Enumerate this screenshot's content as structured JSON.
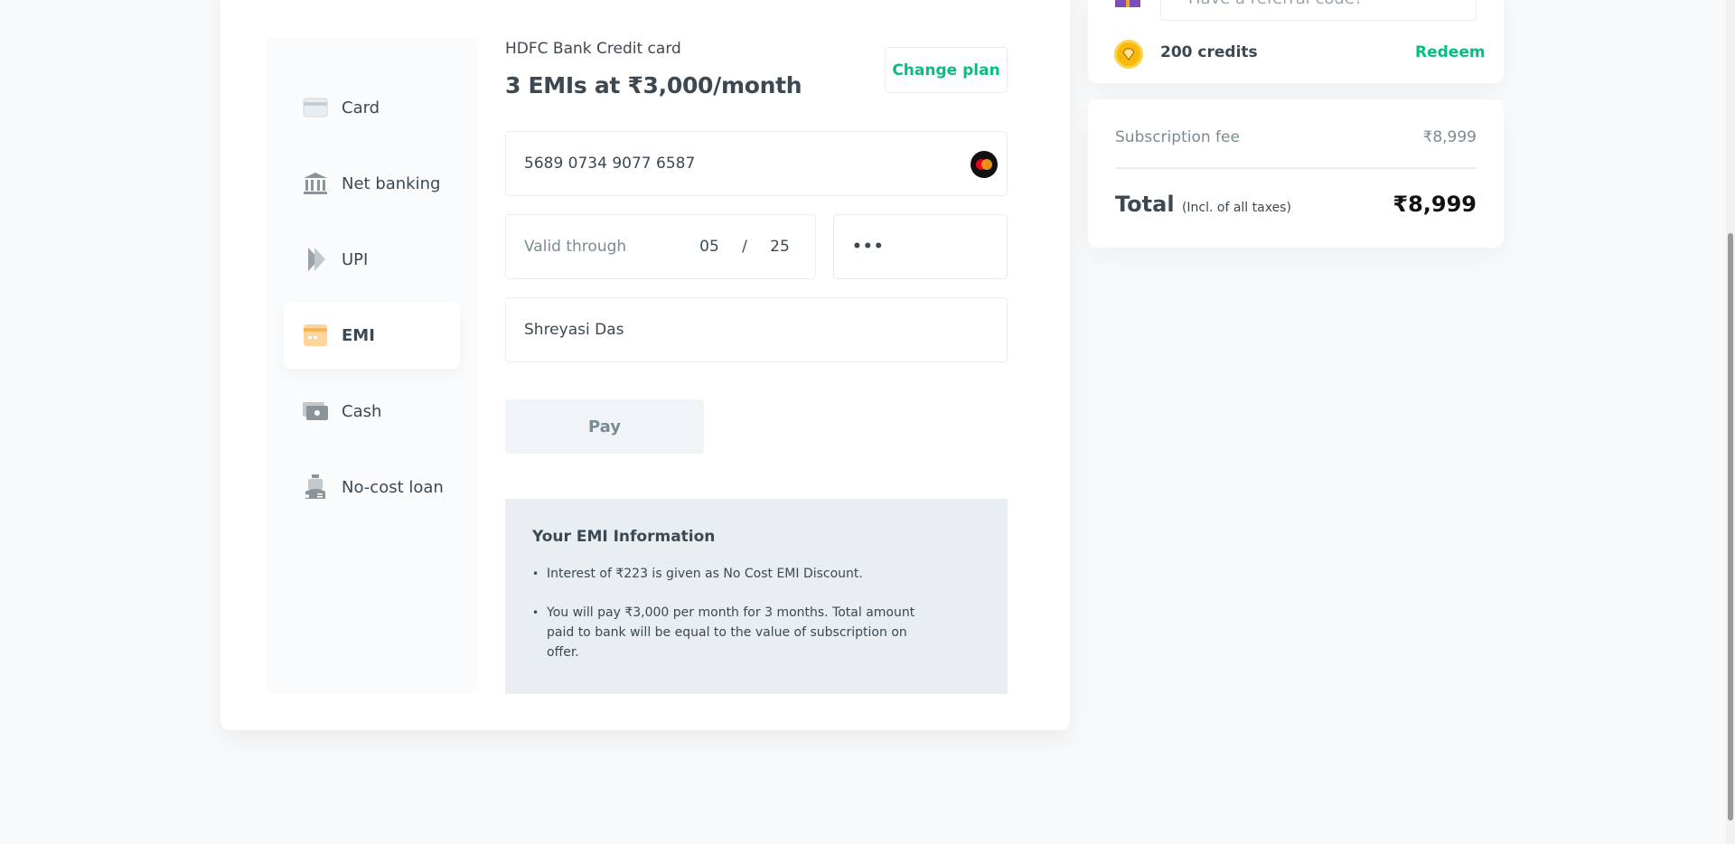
{
  "payment_methods": [
    {
      "label": "Card",
      "icon": "card-icon"
    },
    {
      "label": "Net banking",
      "icon": "bank-icon"
    },
    {
      "label": "UPI",
      "icon": "upi-icon"
    },
    {
      "label": "EMI",
      "icon": "emi-icon",
      "active": true
    },
    {
      "label": "Cash",
      "icon": "cash-icon"
    },
    {
      "label": "No-cost loan",
      "icon": "loan-icon"
    }
  ],
  "emi": {
    "bank_name": "HDFC Bank Credit card",
    "plan": "3 EMIs at ₹3,000/month",
    "change_plan": "Change plan",
    "card_number": "5689 0734 9077 6587",
    "valid_label": "Valid through",
    "month": "05",
    "slash": "/",
    "year": "25",
    "cvv": "•••",
    "name": "Shreyasi Das",
    "pay_label": "Pay",
    "info_title": "Your EMI Information",
    "info_points": [
      "Interest of ₹223 is given as No Cost EMI Discount.",
      "You will pay ₹3,000 per month for 3 months. Total amount paid to bank will be equal to the value of subscription on offer."
    ]
  },
  "sidebar": {
    "referral_placeholder": "Have a referral code?",
    "credits": "200 credits",
    "redeem": "Redeem",
    "subscription_label": "Subscription fee",
    "subscription_value": "₹8,999",
    "total_label": "Total",
    "total_note": "(Incl. of all taxes)",
    "total_value": "₹8,999"
  },
  "colors": {
    "accent": "#08bd80",
    "text": "#3c4852",
    "muted": "#7a8b94"
  }
}
